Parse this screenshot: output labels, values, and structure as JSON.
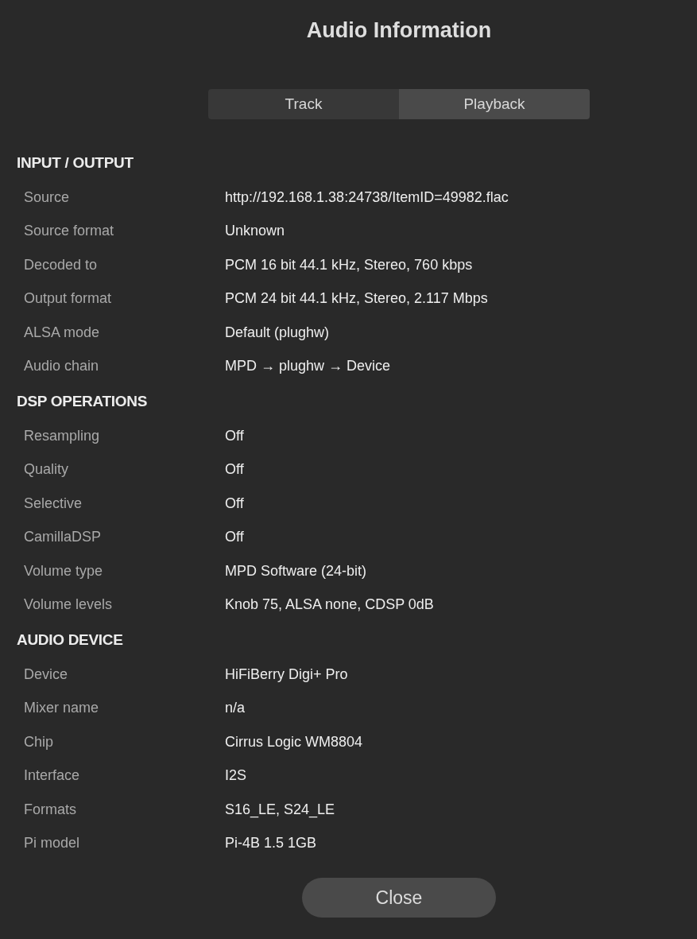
{
  "title": "Audio Information",
  "tabs": [
    {
      "label": "Track",
      "selected": false
    },
    {
      "label": "Playback",
      "selected": true
    }
  ],
  "sections": [
    {
      "heading": "INPUT / OUTPUT",
      "rows": [
        {
          "label": "Source",
          "value": "http://192.168.1.38:24738/ItemID=49982.flac"
        },
        {
          "label": "Source format",
          "value": "Unknown"
        },
        {
          "label": "Decoded to",
          "value": "PCM 16 bit 44.1 kHz, Stereo, 760 kbps"
        },
        {
          "label": "Output format",
          "value": "PCM 24 bit 44.1 kHz, Stereo, 2.117 Mbps"
        },
        {
          "label": "ALSA mode",
          "value": "Default (plughw)"
        },
        {
          "label": "Audio chain",
          "value": "MPD → plughw → Device"
        }
      ]
    },
    {
      "heading": "DSP OPERATIONS",
      "rows": [
        {
          "label": "Resampling",
          "value": "Off"
        },
        {
          "label": "Quality",
          "value": "Off"
        },
        {
          "label": "Selective",
          "value": "Off"
        },
        {
          "label": "CamillaDSP",
          "value": "Off"
        },
        {
          "label": "Volume type",
          "value": "MPD Software (24-bit)"
        },
        {
          "label": "Volume levels",
          "value": "Knob 75, ALSA none, CDSP 0dB"
        }
      ]
    },
    {
      "heading": "AUDIO DEVICE",
      "rows": [
        {
          "label": "Device",
          "value": "HiFiBerry Digi+ Pro"
        },
        {
          "label": "Mixer name",
          "value": "n/a"
        },
        {
          "label": "Chip",
          "value": "Cirrus Logic WM8804"
        },
        {
          "label": "Interface",
          "value": "I2S"
        },
        {
          "label": "Formats",
          "value": "S16_LE, S24_LE"
        },
        {
          "label": "Pi model",
          "value": "Pi-4B 1.5 1GB"
        }
      ]
    }
  ],
  "close_button": "Close"
}
